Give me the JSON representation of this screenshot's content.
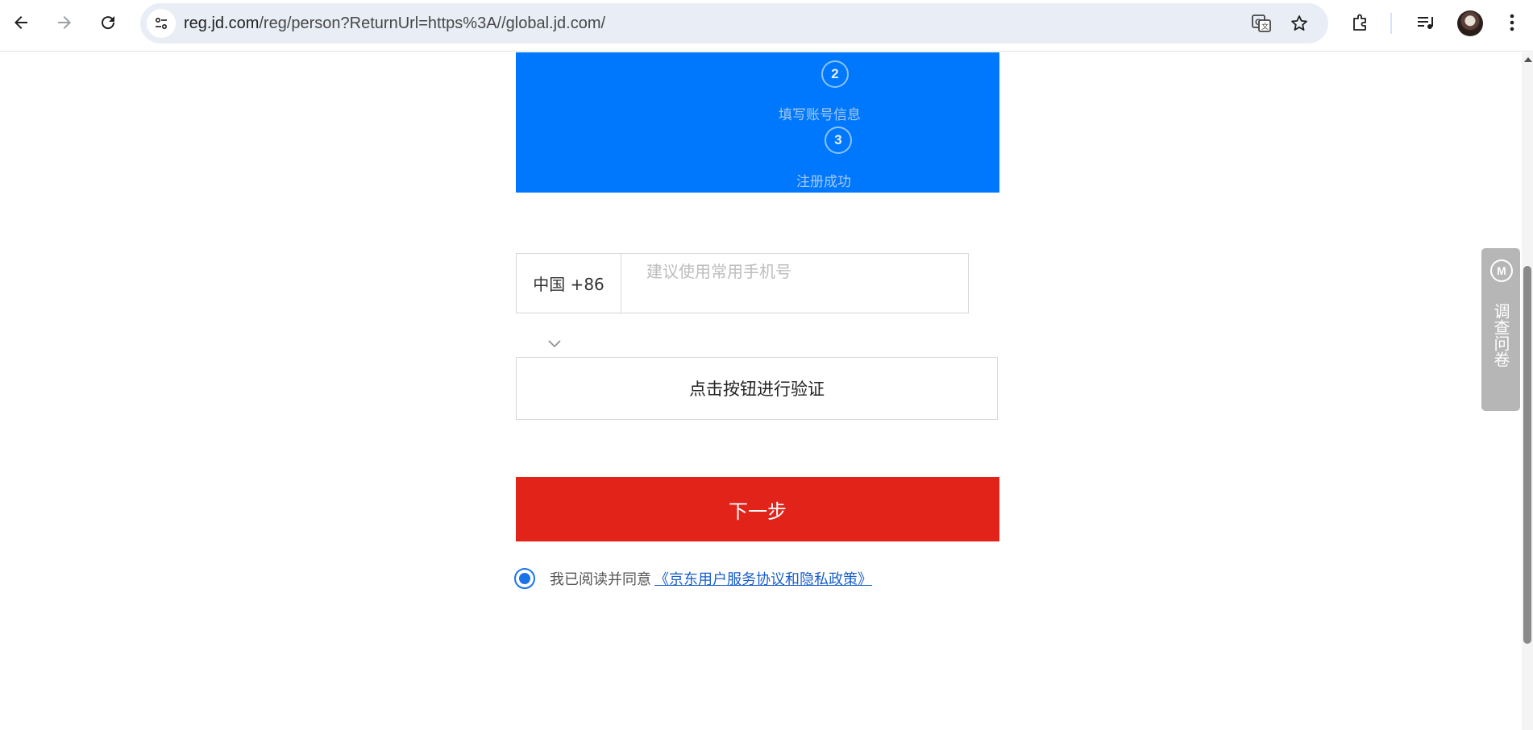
{
  "browser": {
    "url_host": "reg.jd.com",
    "url_path": "/reg/person?ReturnUrl=https%3A//global.jd.com/",
    "icons": [
      "back-icon",
      "forward-icon",
      "reload-icon",
      "site-info-icon",
      "translate-icon",
      "bookmark-star-icon",
      "extensions-icon",
      "media-control-icon",
      "avatar",
      "more-menu-icon"
    ]
  },
  "steps": {
    "step2_number": "2",
    "step2_label": "填写账号信息",
    "step3_number": "3",
    "step3_label": "注册成功"
  },
  "form": {
    "country_code": "中国 +86",
    "phone_placeholder": "建议使用常用手机号",
    "verify_label": "点击按钮进行验证",
    "next_label": "下一步",
    "agree_text": "我已阅读并同意",
    "agree_link": "《京东用户服务协议和隐私政策》",
    "agree_checked": true
  },
  "survey": {
    "logo_text": "M",
    "label": "调查问卷"
  },
  "colors": {
    "banner": "#0078fd",
    "next_button": "#e2231a",
    "link": "#1a5fcc"
  }
}
